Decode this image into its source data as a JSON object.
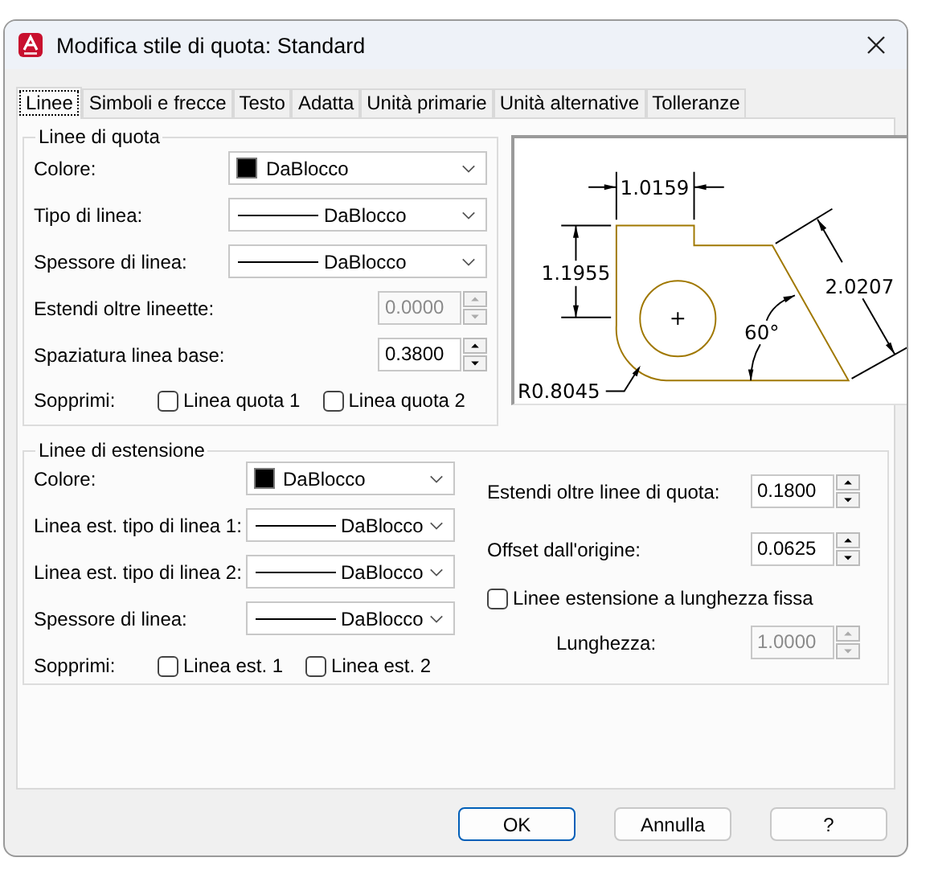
{
  "window": {
    "title": "Modifica stile di quota: Standard"
  },
  "tabs": [
    {
      "label": "Linee",
      "selected": true
    },
    {
      "label": "Simboli e frecce",
      "selected": false
    },
    {
      "label": "Testo",
      "selected": false
    },
    {
      "label": "Adatta",
      "selected": false
    },
    {
      "label": "Unità primarie",
      "selected": false
    },
    {
      "label": "Unità alternative",
      "selected": false
    },
    {
      "label": "Tolleranze",
      "selected": false
    }
  ],
  "dimension_lines": {
    "title": "Linee di quota",
    "fields": [
      {
        "kind": "color",
        "label": "Colore:",
        "value": "DaBlocco",
        "color": "#000000"
      },
      {
        "kind": "linetype",
        "label": "Tipo di linea:",
        "value": "DaBlocco"
      },
      {
        "kind": "linetype",
        "label": "Spessore di linea:",
        "value": "DaBlocco"
      },
      {
        "kind": "spinner",
        "label": "Estendi oltre lineette:",
        "value": "0.0000",
        "disabled": true
      },
      {
        "kind": "spinner",
        "label": "Spaziatura linea base:",
        "value": "0.3800",
        "disabled": false
      }
    ],
    "suppress": {
      "label": "Sopprimi:",
      "options": [
        {
          "label": "Linea quota 1",
          "checked": false
        },
        {
          "label": "Linea quota 2",
          "checked": false
        }
      ]
    }
  },
  "preview": {
    "labels": [
      "1.0159",
      "1.1955",
      "2.0207",
      "60°",
      "R0.8045"
    ]
  },
  "extension_lines": {
    "title": "Linee di estensione",
    "fields": [
      {
        "kind": "color",
        "label": "Colore:",
        "value": "DaBlocco",
        "color": "#000000"
      },
      {
        "kind": "linetype",
        "label": "Linea est. tipo di linea 1:",
        "value": "DaBlocco"
      },
      {
        "kind": "linetype",
        "label": "Linea est. tipo di linea 2:",
        "value": "DaBlocco"
      },
      {
        "kind": "linetype",
        "label": "Spessore di linea:",
        "value": "DaBlocco"
      }
    ],
    "suppress": {
      "label": "Sopprimi:",
      "options": [
        {
          "label": "Linea est. 1",
          "checked": false
        },
        {
          "label": "Linea est. 2",
          "checked": false
        }
      ]
    },
    "right_fields": [
      {
        "kind": "spinner",
        "label": "Estendi oltre linee di quota:",
        "value": "0.1800",
        "disabled": false
      },
      {
        "kind": "spinner",
        "label": "Offset dall'origine:",
        "value": "0.0625",
        "disabled": false
      }
    ],
    "fixed_length": {
      "label": "Linee estensione a lunghezza fissa",
      "checked": false
    },
    "length": {
      "label": "Lunghezza:",
      "value": "1.0000",
      "disabled": true
    }
  },
  "buttons": [
    {
      "label": "OK",
      "default": true
    },
    {
      "label": "Annulla",
      "default": false
    },
    {
      "label": "?",
      "default": false
    }
  ]
}
